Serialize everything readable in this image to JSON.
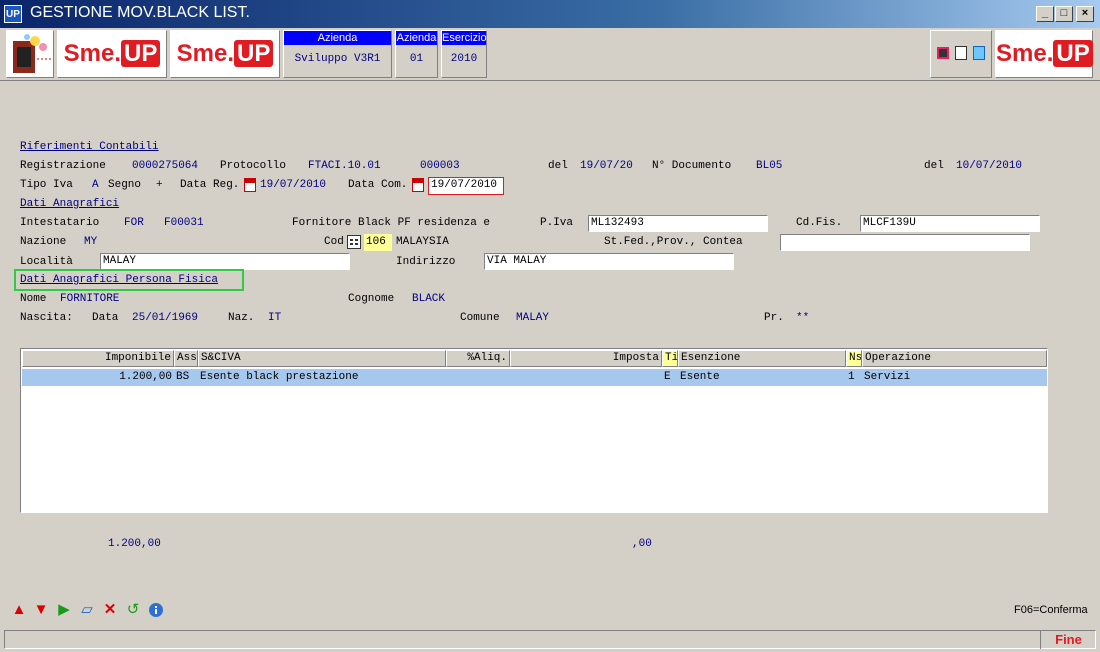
{
  "window": {
    "title": "GESTIONE MOV.BLACK LIST.",
    "app_icon": "UP"
  },
  "toolbar": {
    "logo1": "Sme.",
    "logo1_up": "UP",
    "logo2": "Sme.",
    "logo2_up": "UP",
    "logo3": "Sme.",
    "logo3_up": "UP",
    "azienda_hdr": "Azienda",
    "azienda_val": "Sviluppo V3R1",
    "azienda2_hdr": "Azienda",
    "azienda2_val": "01",
    "esercizio_hdr": "Esercizio",
    "esercizio_val": "2010"
  },
  "rif": {
    "section": "Riferimenti Contabili",
    "registrazione_lbl": "Registrazione",
    "registrazione": "0000275064",
    "protocollo_lbl": "Protocollo",
    "protocollo": "FTACI.10.01",
    "protocollo_num": "000003",
    "del1_lbl": "del",
    "del1": "19/07/20",
    "ndoc_lbl": "N° Documento",
    "ndoc": "BL05",
    "del2_lbl": "del",
    "del2": "10/07/2010",
    "tipoiva_lbl": "Tipo Iva",
    "tipoiva": "A",
    "segno_lbl": "Segno",
    "segno": "+",
    "datareg_lbl": "Data Reg.",
    "datareg": "19/07/2010",
    "datacom_lbl": "Data Com.",
    "datacom": "19/07/2010"
  },
  "anag": {
    "section": "Dati Anagrafici",
    "intestatario_lbl": "Intestatario",
    "intestatario_tipo": "FOR",
    "intestatario": "F00031",
    "descr": "Fornitore Black PF residenza e",
    "piva_lbl": "P.Iva",
    "piva": "ML132493",
    "cdfis_lbl": "Cd.Fis.",
    "cdfis": "MLCF139U",
    "nazione_lbl": "Nazione",
    "nazione": "MY",
    "cod_lbl": "Cod",
    "cod": "106",
    "cod_descr": "MALAYSIA",
    "stfed_lbl": "St.Fed.,Prov., Contea",
    "stfed": "",
    "localita_lbl": "Località",
    "localita": "MALAY",
    "indirizzo_lbl": "Indirizzo",
    "indirizzo": "VIA MALAY"
  },
  "pf": {
    "section": "Dati Anagrafici Persona Fisica",
    "nome_lbl": "Nome",
    "nome": "FORNITORE",
    "cognome_lbl": "Cognome",
    "cognome": "BLACK",
    "nascita_lbl": "Nascita:",
    "data_lbl": "Data",
    "data": "25/01/1969",
    "naz_lbl": "Naz.",
    "naz": "IT",
    "comune_lbl": "Comune",
    "comune": "MALAY",
    "pr_lbl": "Pr.",
    "pr": "**"
  },
  "grid": {
    "headers": [
      "Imponibile",
      "Ass",
      "S&CIVA",
      "%Aliq.",
      "Imposta",
      "Ti",
      "Esenzione",
      "Ns",
      "Operazione"
    ],
    "rows": [
      [
        "1.200,00",
        "BS",
        "Esente black prestazione",
        "",
        "",
        "E",
        "Esente",
        "1",
        "Servizi"
      ]
    ]
  },
  "totals": {
    "imponibile": "1.200,00",
    "imposta": ",00"
  },
  "footer": {
    "hint": "F06=Conferma",
    "status": "Fine"
  }
}
